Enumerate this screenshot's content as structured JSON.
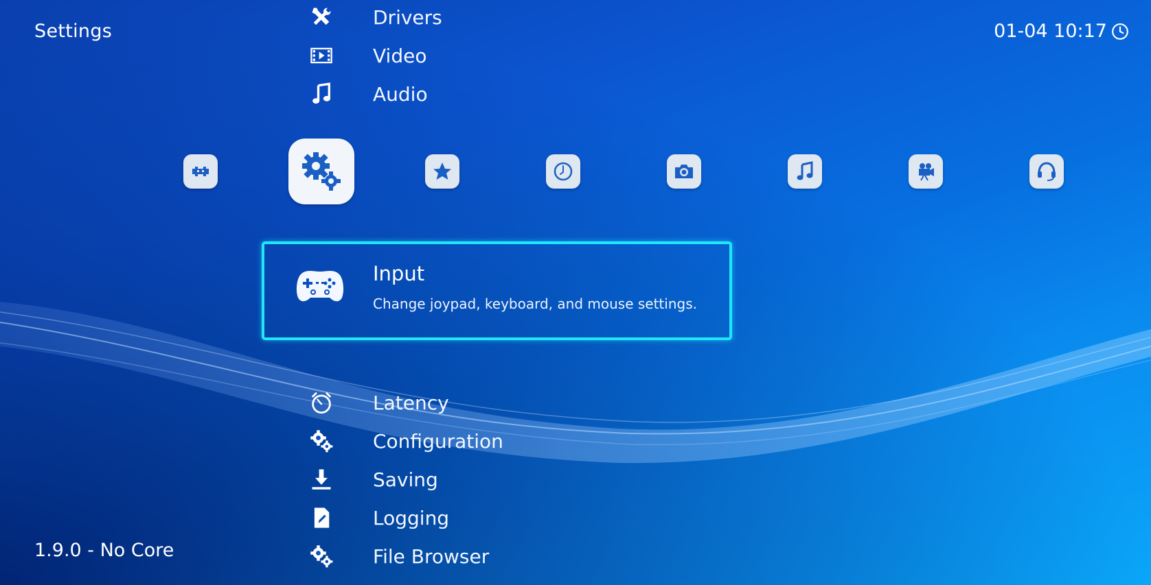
{
  "header": {
    "title": "Settings",
    "datetime": "01-04 10:17",
    "clock_icon": "clock-icon"
  },
  "footer": {
    "version": "1.9.0 - No Core"
  },
  "colors": {
    "background_start": "#0a3fae",
    "background_end": "#0aa6f8",
    "selection_border": "#20e6ff",
    "tab_bg": "#dfe7f1",
    "icon_blue": "#1a5fc4"
  },
  "menu_above": [
    {
      "label": "Drivers",
      "icon": "wrench-screwdriver-icon"
    },
    {
      "label": "Video",
      "icon": "film-icon"
    },
    {
      "label": "Audio",
      "icon": "music-note-icon"
    }
  ],
  "tabs": [
    {
      "name": "main-menu",
      "icon": "retroarch-invader-icon",
      "active": false
    },
    {
      "name": "settings",
      "icon": "gears-icon",
      "active": true
    },
    {
      "name": "favorites",
      "icon": "star-icon",
      "active": false
    },
    {
      "name": "history",
      "icon": "clock-icon",
      "active": false
    },
    {
      "name": "images",
      "icon": "camera-icon",
      "active": false
    },
    {
      "name": "music",
      "icon": "music-icon",
      "active": false
    },
    {
      "name": "videos",
      "icon": "video-camera-icon",
      "active": false
    },
    {
      "name": "netplay",
      "icon": "headset-icon",
      "active": false
    }
  ],
  "selected": {
    "title": "Input",
    "description": "Change joypad, keyboard, and mouse settings.",
    "icon": "gamepad-icon"
  },
  "menu_below": [
    {
      "label": "Latency",
      "icon": "stopwatch-icon"
    },
    {
      "label": "Configuration",
      "icon": "gears-icon"
    },
    {
      "label": "Saving",
      "icon": "download-icon"
    },
    {
      "label": "Logging",
      "icon": "document-edit-icon"
    },
    {
      "label": "File Browser",
      "icon": "gears-icon"
    }
  ]
}
